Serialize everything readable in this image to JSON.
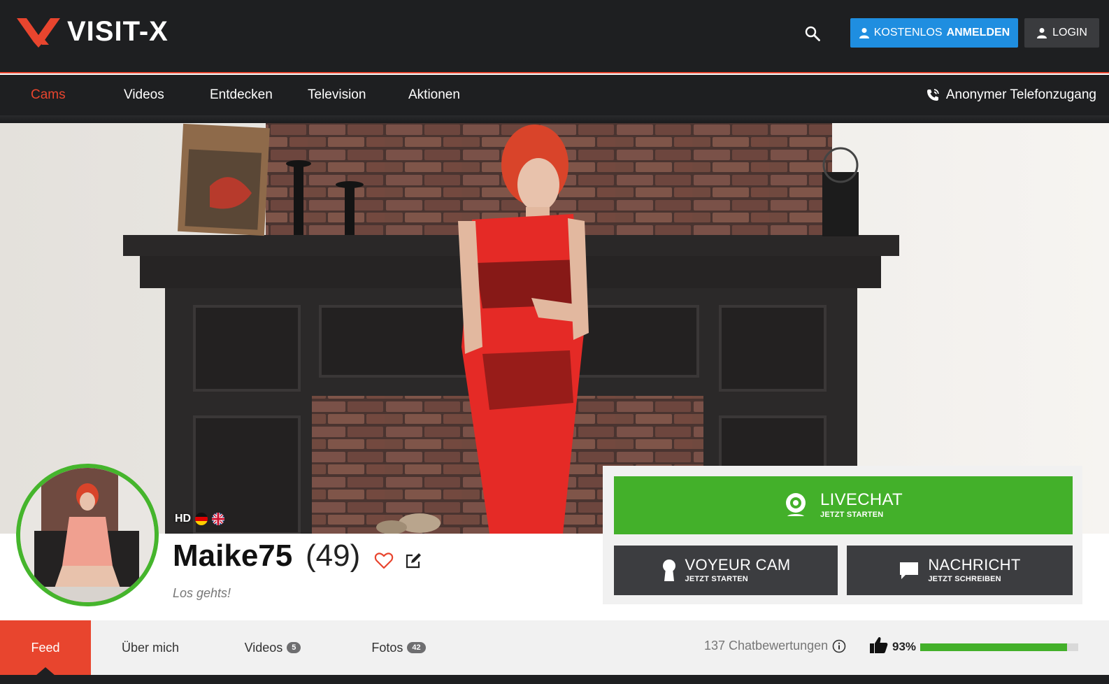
{
  "brand": {
    "name": "VISIT-X",
    "accent": "#e8452e",
    "green": "#43b02a",
    "blue": "#1f8ee0"
  },
  "header": {
    "search_icon": "search-icon",
    "register_prefix": "KOSTENLOS",
    "register_main": "ANMELDEN",
    "login_label": "LOGIN"
  },
  "nav": {
    "items": [
      {
        "label": "Cams"
      },
      {
        "label": "Videos"
      },
      {
        "label": "Entdecken"
      },
      {
        "label": "Television"
      },
      {
        "label": "Aktionen"
      }
    ],
    "phone_label": "Anonymer Telefonzugang"
  },
  "profile": {
    "hd": "HD",
    "name": "Maike75",
    "age": "(49)",
    "motto": "Los gehts!",
    "languages": [
      "de",
      "en"
    ]
  },
  "actions": {
    "livechat_title": "LIVECHAT",
    "livechat_sub": "JETZT STARTEN",
    "voyeur_title": "VOYEUR CAM",
    "voyeur_sub": "JETZT STARTEN",
    "message_title": "NACHRICHT",
    "message_sub": "JETZT SCHREIBEN"
  },
  "tabs": {
    "feed": "Feed",
    "about": "Über mich",
    "videos": "Videos",
    "videos_count": "5",
    "photos": "Fotos",
    "photos_count": "42"
  },
  "rating": {
    "count_label": "137 Chatbewertungen",
    "percent_label": "93%",
    "percent_value": 93
  }
}
